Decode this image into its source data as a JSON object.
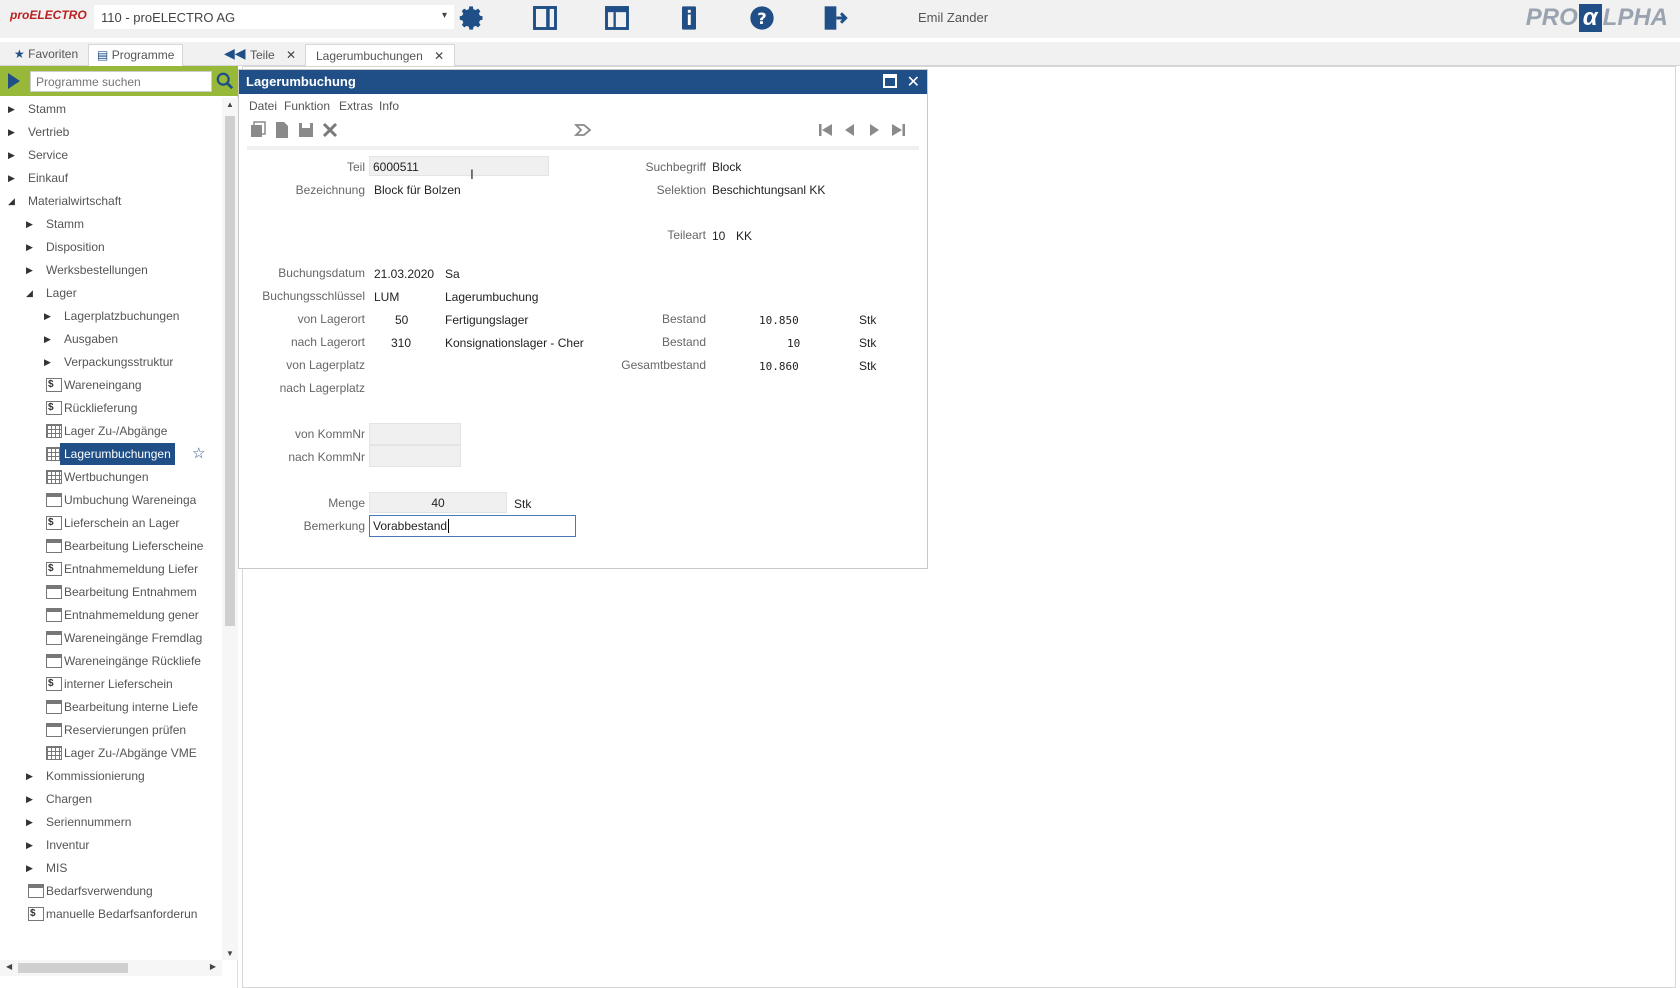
{
  "app": {
    "logo_text": "proELECTRO",
    "company": "110 - proELECTRO AG",
    "user": "Emil Zander",
    "brand": "PROALPHA",
    "toolbar_icons": [
      "gear-icon",
      "panel-icon",
      "layout-icon",
      "info-icon",
      "help-icon",
      "logout-icon"
    ]
  },
  "left_tabs": [
    {
      "icon": "star-icon",
      "label": "Favoriten"
    },
    {
      "icon": "programs-icon",
      "label": "Programme"
    }
  ],
  "doc_tabs": [
    {
      "label": "Teile"
    },
    {
      "label": "Lagerumbuchungen"
    }
  ],
  "sidebar": {
    "search_placeholder": "Programme suchen",
    "tree": [
      {
        "label": "Stamm",
        "level": 0,
        "type": "collapsed"
      },
      {
        "label": "Vertrieb",
        "level": 0,
        "type": "collapsed"
      },
      {
        "label": "Service",
        "level": 0,
        "type": "collapsed"
      },
      {
        "label": "Einkauf",
        "level": 0,
        "type": "collapsed"
      },
      {
        "label": "Materialwirtschaft",
        "level": 0,
        "type": "expanded"
      },
      {
        "label": "Stamm",
        "level": 1,
        "type": "collapsed"
      },
      {
        "label": "Disposition",
        "level": 1,
        "type": "collapsed"
      },
      {
        "label": "Werksbestellungen",
        "level": 1,
        "type": "collapsed"
      },
      {
        "label": "Lager",
        "level": 1,
        "type": "expanded"
      },
      {
        "label": "Lagerplatzbuchungen",
        "level": 2,
        "type": "collapsed"
      },
      {
        "label": "Ausgaben",
        "level": 2,
        "type": "collapsed"
      },
      {
        "label": "Verpackungsstruktur",
        "level": 2,
        "type": "collapsed"
      },
      {
        "label": "Wareneingang",
        "level": 2,
        "type": "doc"
      },
      {
        "label": "Rücklieferung",
        "level": 2,
        "type": "doc"
      },
      {
        "label": "Lager Zu-/Abgänge",
        "level": 2,
        "type": "grid"
      },
      {
        "label": "Lagerumbuchungen",
        "level": 2,
        "type": "grid",
        "selected": true
      },
      {
        "label": "Wertbuchungen",
        "level": 2,
        "type": "grid"
      },
      {
        "label": "Umbuchung Wareneinga",
        "level": 2,
        "type": "win"
      },
      {
        "label": "Lieferschein an Lager",
        "level": 2,
        "type": "doc"
      },
      {
        "label": "Bearbeitung Lieferscheine",
        "level": 2,
        "type": "win"
      },
      {
        "label": "Entnahmemeldung Liefer",
        "level": 2,
        "type": "doc"
      },
      {
        "label": "Bearbeitung Entnahmem",
        "level": 2,
        "type": "win"
      },
      {
        "label": "Entnahmemeldung gener",
        "level": 2,
        "type": "win"
      },
      {
        "label": "Wareneingänge Fremdlag",
        "level": 2,
        "type": "win"
      },
      {
        "label": "Wareneingänge Rückliefe",
        "level": 2,
        "type": "win"
      },
      {
        "label": "interner Lieferschein",
        "level": 2,
        "type": "doc"
      },
      {
        "label": "Bearbeitung interne Liefe",
        "level": 2,
        "type": "win"
      },
      {
        "label": "Reservierungen prüfen",
        "level": 2,
        "type": "win"
      },
      {
        "label": "Lager Zu-/Abgänge VME",
        "level": 2,
        "type": "grid"
      },
      {
        "label": "Kommissionierung",
        "level": 1,
        "type": "collapsed"
      },
      {
        "label": "Chargen",
        "level": 1,
        "type": "collapsed"
      },
      {
        "label": "Seriennummern",
        "level": 1,
        "type": "collapsed"
      },
      {
        "label": "Inventur",
        "level": 1,
        "type": "collapsed"
      },
      {
        "label": "MIS",
        "level": 1,
        "type": "collapsed"
      },
      {
        "label": "Bedarfsverwendung",
        "level": 1,
        "type": "win"
      },
      {
        "label": "manuelle Bedarfsanforderun",
        "level": 1,
        "type": "doc"
      }
    ]
  },
  "dialog": {
    "title": "Lagerumbuchung",
    "menu": [
      "Datei",
      "Funktion",
      "Extras",
      "Info"
    ],
    "fields": {
      "teil_label": "Teil",
      "teil_value": "6000511",
      "bezeichnung_label": "Bezeichnung",
      "bezeichnung_value": "Block für Bolzen",
      "suchbegriff_label": "Suchbegriff",
      "suchbegriff_value": "Block",
      "selektion_label": "Selektion",
      "selektion_value": "Beschichtungsanl KK",
      "teileart_label": "Teileart",
      "teileart_code": "10",
      "teileart_value": "KK",
      "buchungsdatum_label": "Buchungsdatum",
      "buchungsdatum_value": "21.03.2020",
      "buchungsdatum_day": "Sa",
      "buchungsschluessel_label": "Buchungsschlüssel",
      "buchungsschluessel_value": "LUM",
      "buchungsschluessel_desc": "Lagerumbuchung",
      "von_lagerort_label": "von Lagerort",
      "von_lagerort_value": "50",
      "von_lagerort_desc": "Fertigungslager",
      "nach_lagerort_label": "nach Lagerort",
      "nach_lagerort_value": "310",
      "nach_lagerort_desc": "Konsignationslager - Cher",
      "bestand1_label": "Bestand",
      "bestand1_value": "10.850",
      "bestand1_unit": "Stk",
      "bestand2_label": "Bestand",
      "bestand2_value": "10",
      "bestand2_unit": "Stk",
      "gesamtbestand_label": "Gesamtbestand",
      "gesamtbestand_value": "10.860",
      "gesamtbestand_unit": "Stk",
      "von_lagerplatz_label": "von Lagerplatz",
      "nach_lagerplatz_label": "nach Lagerplatz",
      "von_kommnr_label": "von KommNr",
      "nach_kommnr_label": "nach KommNr",
      "menge_label": "Menge",
      "menge_value": "40",
      "menge_unit": "Stk",
      "bemerkung_label": "Bemerkung",
      "bemerkung_value": "Vorabbestand"
    }
  }
}
